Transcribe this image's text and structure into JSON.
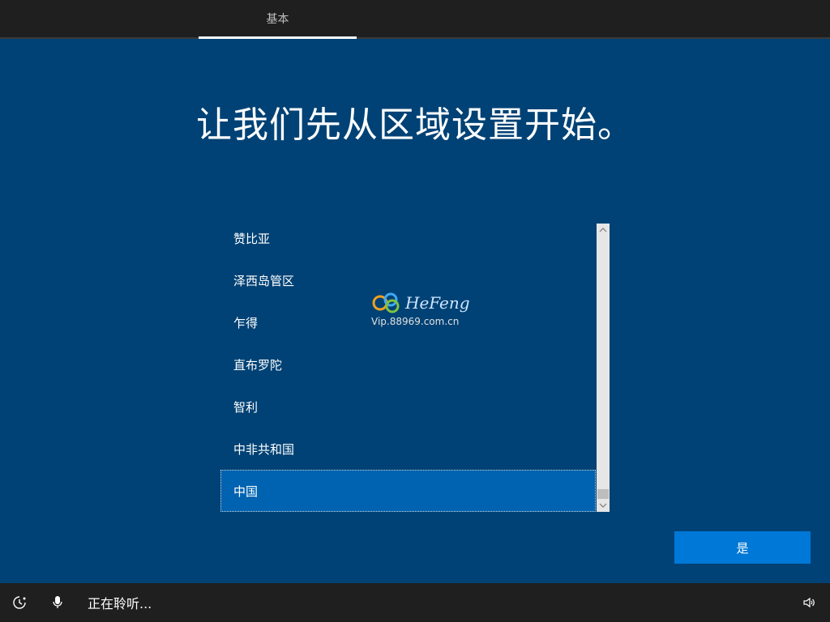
{
  "header": {
    "tab_label": "基本"
  },
  "main": {
    "title": "让我们先从区域设置开始。",
    "regions": [
      {
        "label": "赞比亚"
      },
      {
        "label": "泽西岛管区"
      },
      {
        "label": "乍得"
      },
      {
        "label": "直布罗陀"
      },
      {
        "label": "智利"
      },
      {
        "label": "中非共和国"
      },
      {
        "label": "中国",
        "selected": true
      }
    ],
    "yes_button": "是"
  },
  "watermark": {
    "brand": "HeFeng",
    "url": "Vip.88969.com.cn"
  },
  "footer": {
    "listening_text": "正在聆听...",
    "icons": [
      "accessibility-icon",
      "microphone-icon",
      "volume-icon"
    ]
  },
  "colors": {
    "background": "#004275",
    "selection": "#0063b1",
    "button": "#0078d7",
    "bars": "#1f1f1f"
  }
}
